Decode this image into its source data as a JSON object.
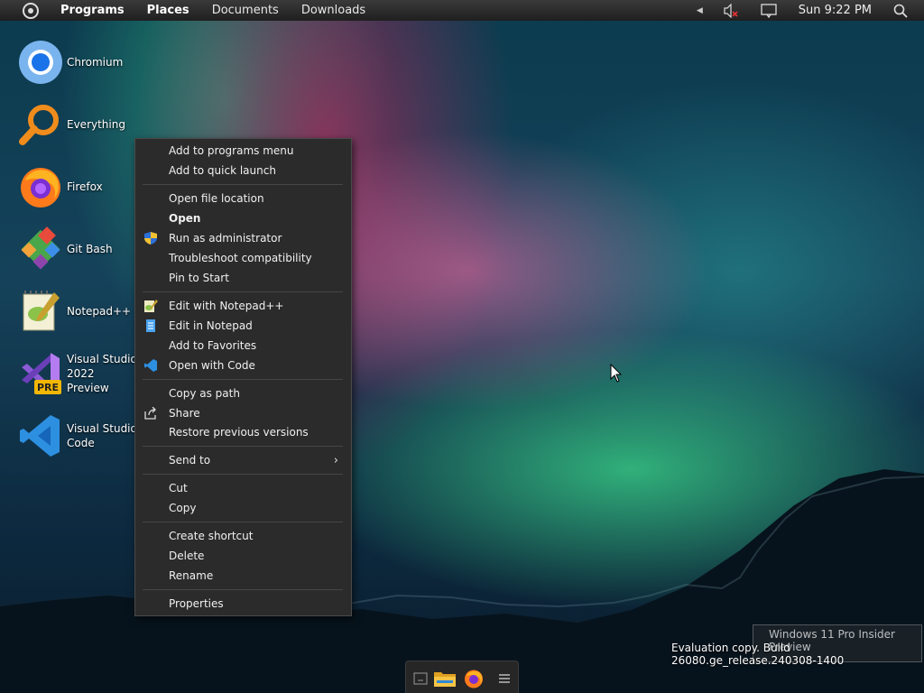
{
  "topbar": {
    "menus": [
      "Programs",
      "Places",
      "Documents",
      "Downloads"
    ],
    "clock": "Sun 9:22 PM"
  },
  "desktop_icons": [
    {
      "label": "Chromium",
      "icon": "chromium-icon"
    },
    {
      "label": "Everything",
      "icon": "everything-icon"
    },
    {
      "label": "Firefox",
      "icon": "firefox-icon"
    },
    {
      "label": "Git Bash",
      "icon": "git-bash-icon"
    },
    {
      "label": "Notepad++",
      "icon": "notepad-plus-plus-icon"
    },
    {
      "label": "Visual Studio 2022 Preview",
      "icon": "visual-studio-preview-icon",
      "badge": "PRE"
    },
    {
      "label": "Visual Studio Code",
      "icon": "vscode-icon"
    }
  ],
  "context_menu": {
    "groups": [
      [
        "Add to programs menu",
        "Add to quick launch"
      ],
      [
        "Open file location",
        "Open",
        "Run as administrator",
        "Troubleshoot compatibility",
        "Pin to Start"
      ],
      [
        "Edit with Notepad++",
        "Edit in Notepad",
        "Add to Favorites",
        "Open with Code"
      ],
      [
        "Copy as path",
        "Share",
        "Restore previous versions"
      ],
      [
        "Send to"
      ],
      [
        "Cut",
        "Copy"
      ],
      [
        "Create shortcut",
        "Delete",
        "Rename"
      ],
      [
        "Properties"
      ]
    ],
    "icons": {
      "Run as administrator": "shield-icon",
      "Edit with Notepad++": "notepad-plus-plus-icon",
      "Edit in Notepad": "notepad-icon",
      "Open with Code": "vscode-icon",
      "Share": "share-icon"
    },
    "default_item": "Open",
    "submenu_items": [
      "Send to"
    ]
  },
  "watermark": {
    "line1": "Windows 11 Pro Insider Preview",
    "line2": "Evaluation copy. Build 26080.ge_release.240308-1400"
  },
  "dock": [
    "show-desktop-icon",
    "file-explorer-icon",
    "firefox-icon",
    "menu-icon"
  ],
  "colors": {
    "menu_bg": "#2b2b2b",
    "topbar_bg": "#1f1f1f",
    "vscode_blue": "#2d8fe0",
    "folder_yellow": "#f2c04a"
  }
}
